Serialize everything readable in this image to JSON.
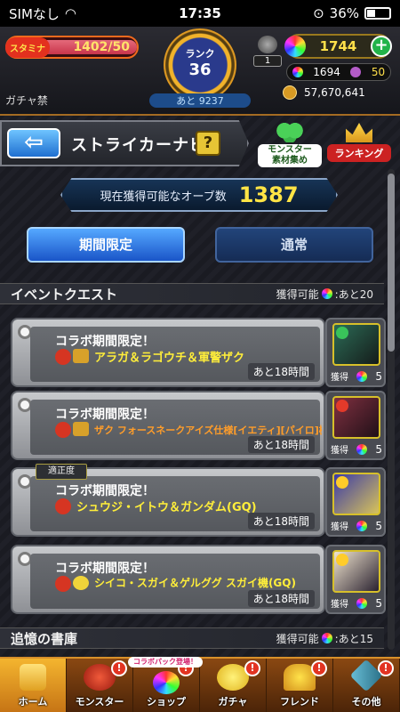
{
  "status_bar": {
    "carrier": "SIMなし",
    "time": "17:35",
    "battery": "36%"
  },
  "header": {
    "stamina_label": "スタミナ",
    "stamina_value": "1402/50",
    "gacha_ban": "ガチャ禁",
    "rank_label": "ランク",
    "rank_value": "36",
    "exp_remaining": "あと 9237",
    "friend_count": "1",
    "orbs": "1744",
    "orbs_paid": "1694",
    "orbs_other": "50",
    "gold": "57,670,641"
  },
  "nav": {
    "back_icon": "arrow-left-icon",
    "title": "ストライカーナビ",
    "help": "?",
    "shortcut_material": "素材集め",
    "shortcut_monster": "モンスター",
    "shortcut_ranking": "ランキング"
  },
  "orb_panel": {
    "label": "現在獲得可能なオーブ数",
    "value": "1387"
  },
  "tabs": [
    {
      "label": "期間限定",
      "active": true
    },
    {
      "label": "通常",
      "active": false
    }
  ],
  "sections": [
    {
      "title": "イベントクエスト",
      "available": "獲得可能",
      "remaining": ":あと20"
    },
    {
      "title": "追憶の書庫",
      "available": "獲得可能",
      "remaining": ":あと15"
    }
  ],
  "quests": [
    {
      "label": "コラボ期間限定！",
      "name": "アラガ＆ラゴウチ＆軍警ザク",
      "time": "あと18時間",
      "get_label": "獲得",
      "get_count": "5",
      "badge": ""
    },
    {
      "label": "コラボ期間限定！",
      "name": "ザク フォースネークアイズ仕様[イエティ][パイロ]機",
      "time": "あと18時間",
      "get_label": "獲得",
      "get_count": "5",
      "badge": ""
    },
    {
      "label": "コラボ期間限定！",
      "name": "シュウジ・イトウ＆ガンダム(GQ)",
      "time": "あと18時間",
      "get_label": "獲得",
      "get_count": "5",
      "badge": "適正度"
    },
    {
      "label": "コラボ期間限定！",
      "name": "シイコ・スガイ＆ゲルググ スガイ機(GQ)",
      "time": "あと18時間",
      "get_label": "獲得",
      "get_count": "5",
      "badge": ""
    }
  ],
  "bottom_nav": [
    {
      "label": "ホーム",
      "icon": "home-icon",
      "badge": ""
    },
    {
      "label": "モンスター",
      "icon": "monster-icon",
      "badge": "!"
    },
    {
      "label": "ショップ",
      "icon": "shop-orb-icon",
      "badge": "!",
      "tag": "コラボパック登場！"
    },
    {
      "label": "ガチャ",
      "icon": "gacha-icon",
      "badge": "!"
    },
    {
      "label": "フレンド",
      "icon": "friend-icon",
      "badge": "!"
    },
    {
      "label": "その他",
      "icon": "other-icon",
      "badge": "!"
    }
  ],
  "colors": {
    "accent_gold": "#ffe445",
    "tab_active": "#1a55c8",
    "quest_name": "#ffee3a"
  }
}
